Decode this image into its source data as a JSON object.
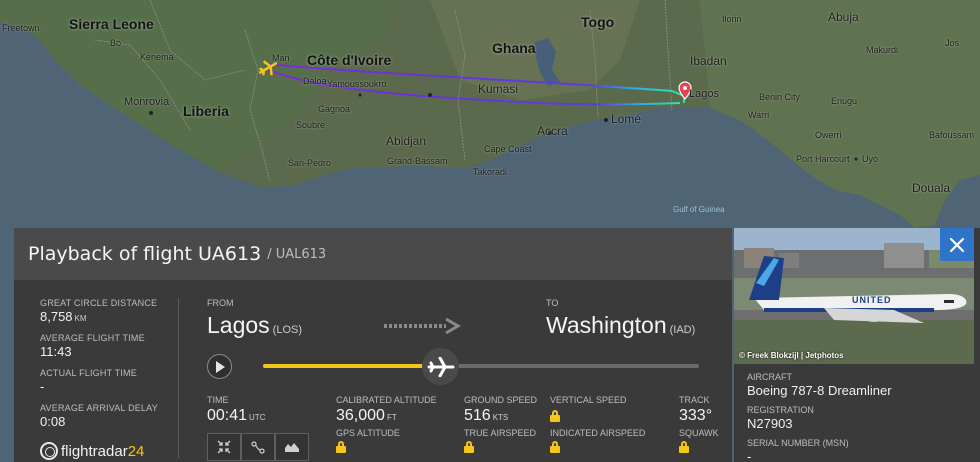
{
  "map": {
    "countries": [
      "Sierra Leone",
      "Côte d'Ivoire",
      "Ghana",
      "Togo",
      "Liberia"
    ],
    "cities": [
      "Freetown",
      "Bo",
      "Kenema",
      "Monrovia",
      "Man",
      "Daloa",
      "Yamoussoukro",
      "Gagnoa",
      "Soubre",
      "San-Pedro",
      "Abidjan",
      "Grand-Bassam",
      "Kumasi",
      "Cape Coast",
      "Takoradi",
      "Accra",
      "Lomé",
      "Lagos",
      "Ibadan",
      "Abuja",
      "Ilorin",
      "Makurdi",
      "Benin City",
      "Warri",
      "Owerri",
      "Port Harcourt",
      "Uyo",
      "Enugu",
      "Bafoussam",
      "Douala",
      "Jos"
    ],
    "water": "Gulf of Guinea",
    "colors": {
      "route_start": "#7a2bd6",
      "route_end": "#2fe0b0",
      "destination_pin": "#e8434a"
    }
  },
  "panel": {
    "title": "Playback of flight UA613",
    "subtitle": "/ UAL613",
    "stats": [
      {
        "label": "GREAT CIRCLE DISTANCE",
        "value": "8,758",
        "unit": "KM"
      },
      {
        "label": "AVERAGE FLIGHT TIME",
        "value": "11:43",
        "unit": ""
      },
      {
        "label": "ACTUAL FLIGHT TIME",
        "value": "-",
        "unit": ""
      },
      {
        "label": "AVERAGE ARRIVAL DELAY",
        "value": "0:08",
        "unit": ""
      }
    ],
    "from": {
      "label": "FROM",
      "city": "Lagos",
      "code": "(LOS)"
    },
    "to": {
      "label": "TO",
      "city": "Washington",
      "code": "(IAD)"
    },
    "playback_progress": 0.42,
    "details": {
      "time": {
        "label": "TIME",
        "value": "00:41",
        "unit": "UTC"
      },
      "calibrated_altitude": {
        "label": "CALIBRATED ALTITUDE",
        "value": "36,000",
        "unit": "FT",
        "sub": "GPS ALTITUDE"
      },
      "ground_speed": {
        "label": "GROUND SPEED",
        "value": "516",
        "unit": "KTS",
        "sub": "TRUE AIRSPEED"
      },
      "vertical_speed": {
        "label": "VERTICAL SPEED",
        "sub": "INDICATED AIRSPEED"
      },
      "track": {
        "label": "TRACK",
        "value": "333°",
        "sub": "SQUAWK"
      }
    },
    "logo": {
      "text_main": "flightradar",
      "text_accent": "24"
    },
    "icons": {
      "play": "play-icon",
      "tools": [
        "compress-icon",
        "route-icon",
        "altitude-graph-icon"
      ]
    }
  },
  "aircraft": {
    "photo_credit": "© Freek Blokzijl | Jetphotos",
    "livery_text": "UNITED",
    "aircraft_label": "AIRCRAFT",
    "aircraft_value": "Boeing 787-8 Dreamliner",
    "registration_label": "REGISTRATION",
    "registration_value": "N27903",
    "serial_label": "SERIAL NUMBER (MSN)",
    "serial_value": "-",
    "close_icon": "close-icon"
  }
}
